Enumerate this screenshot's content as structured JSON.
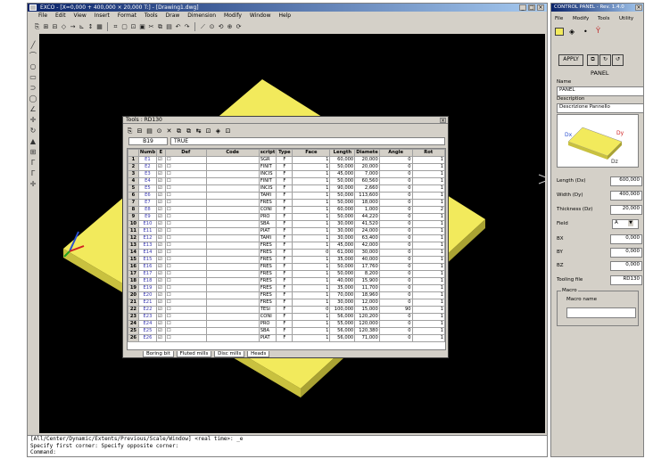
{
  "main_window": {
    "title": "EXCO - [X=0,000 + 400,000 × 20,000 T:] - [Drawing1.dwg]",
    "menu": [
      "File",
      "Edit",
      "View",
      "Insert",
      "Format",
      "Tools",
      "Draw",
      "Dimension",
      "Modify",
      "Window",
      "Help"
    ],
    "min_label": "_",
    "max_label": "□",
    "close_label": "×"
  },
  "toolbar_icons": [
    "⎘",
    "⊞",
    "⊟",
    "◇",
    "→",
    "⊾",
    "↕",
    "▦",
    "⌗",
    "▢",
    "⊡",
    "▣",
    "✂",
    "⧉",
    "▤",
    "↶",
    "↷",
    "⟋",
    "⊙",
    "⟲",
    "⊕",
    "⟳"
  ],
  "left_tools": [
    "╱",
    "⌒",
    "○",
    "▭",
    "⊃",
    "◯",
    "∠",
    "✛",
    "↻",
    "▲",
    "⊞",
    "Γ",
    "Γ",
    "✛"
  ],
  "command_line": {
    "line1": "[All/Center/Dynamic/Extents/Previous/Scale/Window] <real time>: _e",
    "line2": "Specify first corner: Specify opposite corner:",
    "line3": "Command:"
  },
  "tools_dialog": {
    "title": "Tools : RD130",
    "close_label": "×",
    "toolbar_icons": [
      "⎘",
      "⊟",
      "▤",
      "⊙",
      "✕",
      "⧉",
      "⧉",
      "↹",
      "⊡",
      "◈",
      "⊡"
    ],
    "cell_ref": "B19",
    "cell_value": "TRUE",
    "headers": [
      "",
      "Numb",
      "E",
      "Def",
      "Code",
      "script",
      "Type",
      "Face",
      "Length",
      "Diamete",
      "Angle",
      "Rot"
    ],
    "rows": [
      [
        "1",
        "E1",
        "☑",
        "☐",
        "",
        "SGR",
        "F",
        "1",
        "60,000",
        "20,000",
        "0",
        "1"
      ],
      [
        "2",
        "E2",
        "☑",
        "☐",
        "",
        "FINIT",
        "F",
        "1",
        "50,000",
        "20,000",
        "0",
        "1"
      ],
      [
        "3",
        "E3",
        "☑",
        "☐",
        "",
        "INCIS",
        "F",
        "1",
        "45,000",
        "7,000",
        "0",
        "1"
      ],
      [
        "4",
        "E4",
        "☑",
        "☐",
        "",
        "FINIT",
        "F",
        "1",
        "50,000",
        "60,560",
        "0",
        "1"
      ],
      [
        "5",
        "E5",
        "☑",
        "☐",
        "",
        "INCIS",
        "F",
        "1",
        "90,000",
        "2,660",
        "0",
        "1"
      ],
      [
        "6",
        "E6",
        "☑",
        "☐",
        "",
        "TAMI",
        "F",
        "1",
        "50,000",
        "113,600",
        "0",
        "1"
      ],
      [
        "7",
        "E7",
        "☑",
        "☐",
        "",
        "FRES",
        "F",
        "1",
        "50,000",
        "18,000",
        "0",
        "1"
      ],
      [
        "8",
        "E8",
        "☑",
        "☐",
        "",
        "CONI",
        "F",
        "1",
        "60,000",
        "1,000",
        "0",
        "2"
      ],
      [
        "9",
        "E9",
        "☑",
        "☐",
        "",
        "PRO",
        "F",
        "1",
        "50,000",
        "44,220",
        "0",
        "1"
      ],
      [
        "10",
        "E10",
        "☑",
        "☐",
        "",
        "SBA",
        "F",
        "1",
        "30,000",
        "41,520",
        "0",
        "1"
      ],
      [
        "11",
        "E11",
        "☑",
        "☐",
        "",
        "PIAT",
        "F",
        "1",
        "30,000",
        "24,000",
        "0",
        "1"
      ],
      [
        "12",
        "E12",
        "☑",
        "☐",
        "",
        "TAMI",
        "F",
        "1",
        "30,000",
        "63,400",
        "0",
        "1"
      ],
      [
        "13",
        "E13",
        "☑",
        "☐",
        "",
        "FRES",
        "F",
        "1",
        "45,000",
        "42,000",
        "0",
        "1"
      ],
      [
        "14",
        "E14",
        "☑",
        "☐",
        "",
        "FRES",
        "F",
        "0",
        "61,000",
        "30,000",
        "0",
        "1"
      ],
      [
        "15",
        "E15",
        "☑",
        "☐",
        "",
        "FRES",
        "F",
        "1",
        "35,000",
        "40,000",
        "0",
        "1"
      ],
      [
        "16",
        "E16",
        "☑",
        "☐",
        "",
        "FRES",
        "F",
        "1",
        "50,000",
        "17,760",
        "0",
        "1"
      ],
      [
        "17",
        "E17",
        "☑",
        "☐",
        "",
        "FRES",
        "F",
        "1",
        "50,000",
        "8,200",
        "0",
        "1"
      ],
      [
        "18",
        "E18",
        "☑",
        "☐",
        "",
        "FRES",
        "F",
        "1",
        "40,000",
        "15,900",
        "0",
        "1"
      ],
      [
        "19",
        "E19",
        "☑",
        "☐",
        "",
        "FRES",
        "F",
        "1",
        "35,000",
        "11,700",
        "0",
        "1"
      ],
      [
        "20",
        "E20",
        "☑",
        "☐",
        "",
        "FRES",
        "F",
        "1",
        "70,000",
        "18,960",
        "0",
        "1"
      ],
      [
        "21",
        "E21",
        "☑",
        "☐",
        "",
        "FRES",
        "F",
        "1",
        "30,000",
        "12,000",
        "0",
        "1"
      ],
      [
        "22",
        "E22",
        "☑",
        "☐",
        "",
        "TESI",
        "F",
        "0",
        "100,000",
        "15,000",
        "90",
        "1"
      ],
      [
        "23",
        "E23",
        "☑",
        "☐",
        "",
        "CONI",
        "F",
        "1",
        "56,000",
        "120,200",
        "0",
        "1"
      ],
      [
        "24",
        "E24",
        "☑",
        "☐",
        "",
        "PRO",
        "F",
        "1",
        "55,000",
        "120,000",
        "0",
        "1"
      ],
      [
        "25",
        "E25",
        "☑",
        "☐",
        "",
        "SBA",
        "F",
        "1",
        "56,000",
        "120,380",
        "0",
        "1"
      ],
      [
        "26",
        "E26",
        "☑",
        "☐",
        "",
        "PIAT",
        "F",
        "1",
        "56,000",
        "71,000",
        "0",
        "1"
      ]
    ],
    "sheet_tabs": [
      "Boring bit",
      "Fluted mills",
      "Disc mills",
      "Heads"
    ]
  },
  "control_panel": {
    "title": "CONTROL PANEL - Rev. 1.4.0",
    "close_label": "×",
    "menu": [
      "File",
      "Modify",
      "Tools",
      "Utility"
    ],
    "apply_label": "APPLY",
    "heading": "PANEL",
    "name_label": "Name",
    "name_value": "PANEL",
    "description_label": "Description",
    "description_value": "Descrizione Pannello",
    "preview_labels": {
      "dx": "Dx",
      "dy": "Dy",
      "dz": "Dz"
    },
    "fields": [
      {
        "label": "Length  (Dx)",
        "value": "600,000"
      },
      {
        "label": "Width   (Dy)",
        "value": "400,000"
      },
      {
        "label": "Thickness (Dz)",
        "value": "20,000"
      }
    ],
    "field_label": "Field",
    "field_value": "A",
    "offsets": [
      {
        "label": "BX",
        "value": "0,000"
      },
      {
        "label": "BY",
        "value": "0,000"
      },
      {
        "label": "BZ",
        "value": "0,000"
      }
    ],
    "tooling_label": "Tooling file",
    "tooling_value": "RD130",
    "macro_group": "Macro",
    "macro_name_label": "Macro name",
    "macro_name_value": ""
  },
  "colors": {
    "panel_yellow": "#f2ea5c",
    "panel_side": "#c9c13f",
    "viewport_bg": "#000000",
    "titlebar": "#0a246a"
  }
}
